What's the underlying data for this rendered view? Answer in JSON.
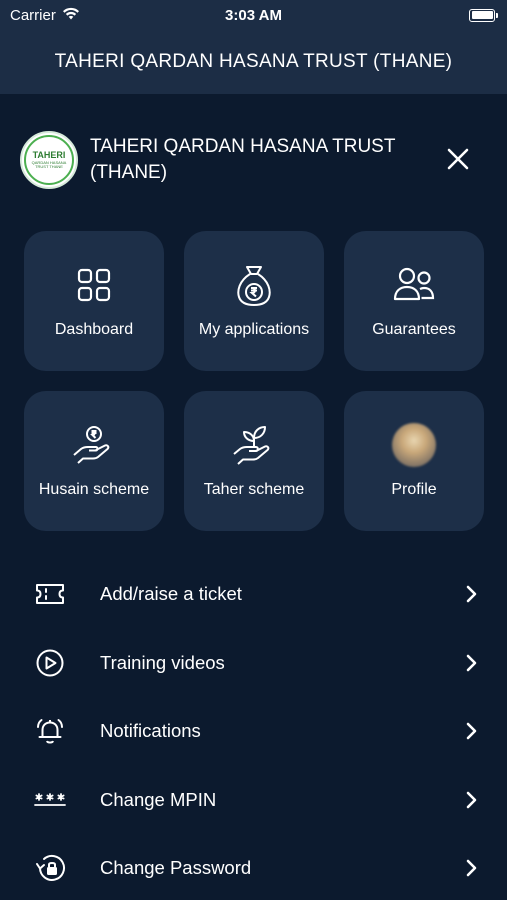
{
  "status_bar": {
    "carrier": "Carrier",
    "time": "3:03 AM"
  },
  "header": {
    "title": "TAHERI QARDAN HASANA TRUST (THANE)"
  },
  "org": {
    "logo_text": "TAHERI",
    "logo_subtext": "QARDAN HASANA TRUST THANE",
    "name": "TAHERI QARDAN HASANA TRUST (THANE)"
  },
  "tiles": [
    {
      "label": "Dashboard",
      "icon": "grid-icon"
    },
    {
      "label": "My applications",
      "icon": "money-bag-icon"
    },
    {
      "label": "Guarantees",
      "icon": "users-icon"
    },
    {
      "label": "Husain scheme",
      "icon": "hand-coin-icon"
    },
    {
      "label": "Taher scheme",
      "icon": "hand-plant-icon"
    },
    {
      "label": "Profile",
      "icon": "avatar"
    }
  ],
  "menu": [
    {
      "label": "Add/raise a ticket",
      "icon": "ticket-icon"
    },
    {
      "label": "Training videos",
      "icon": "play-circle-icon"
    },
    {
      "label": "Notifications",
      "icon": "bell-icon"
    },
    {
      "label": "Change MPIN",
      "icon": "asterisks-icon"
    },
    {
      "label": "Change Password",
      "icon": "lock-reset-icon"
    }
  ],
  "colors": {
    "background": "#0c1a2e",
    "header": "#1c2d45",
    "tile": "#1d2f48",
    "text": "#ffffff"
  }
}
